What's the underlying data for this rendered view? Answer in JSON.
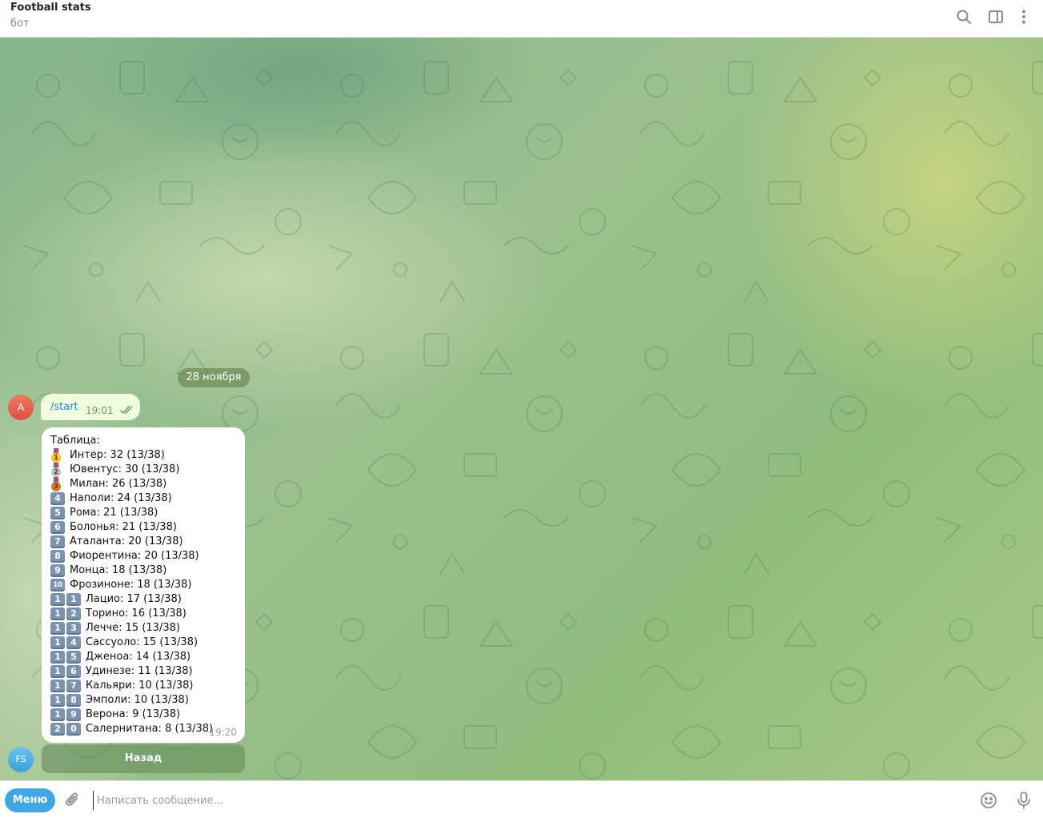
{
  "header": {
    "title": "Football stats",
    "subtitle": "бот"
  },
  "date_separator": "28 ноября",
  "outgoing": {
    "avatar_letter": "A",
    "text": "/start",
    "time": "19:01"
  },
  "incoming": {
    "avatar_letters": "FS",
    "heading": "Таблица:",
    "time": "19:20",
    "rows": [
      {
        "rank": "1",
        "badge": "gold-medal",
        "text": "Интер: 32 (13/38)"
      },
      {
        "rank": "2",
        "badge": "silver-medal",
        "text": "Ювентус: 30 (13/38)"
      },
      {
        "rank": "3",
        "badge": "bronze-medal",
        "text": "Милан: 26 (13/38)"
      },
      {
        "rank": "4",
        "badge": "keycap",
        "text": "Наполи: 24 (13/38)"
      },
      {
        "rank": "5",
        "badge": "keycap",
        "text": "Рома: 21 (13/38)"
      },
      {
        "rank": "6",
        "badge": "keycap",
        "text": "Болонья: 21 (13/38)"
      },
      {
        "rank": "7",
        "badge": "keycap",
        "text": "Аталанта: 20 (13/38)"
      },
      {
        "rank": "8",
        "badge": "keycap",
        "text": "Фиорентина: 20 (13/38)"
      },
      {
        "rank": "9",
        "badge": "keycap",
        "text": "Монца: 18 (13/38)"
      },
      {
        "rank": "10",
        "badge": "keycap",
        "text": "Фрозиноне: 18 (13/38)"
      },
      {
        "rank": "11",
        "badge": "keycap-pair",
        "text": "Лацио: 17 (13/38)"
      },
      {
        "rank": "12",
        "badge": "keycap-pair",
        "text": "Торино: 16 (13/38)"
      },
      {
        "rank": "13",
        "badge": "keycap-pair",
        "text": "Лечче: 15 (13/38)"
      },
      {
        "rank": "14",
        "badge": "keycap-pair",
        "text": "Сассуоло: 15 (13/38)"
      },
      {
        "rank": "15",
        "badge": "keycap-pair",
        "text": "Дженоа: 14 (13/38)"
      },
      {
        "rank": "16",
        "badge": "keycap-pair",
        "text": "Удинезе: 11 (13/38)"
      },
      {
        "rank": "17",
        "badge": "keycap-pair",
        "text": "Кальяри: 10 (13/38)"
      },
      {
        "rank": "18",
        "badge": "keycap-pair",
        "text": "Эмполи: 10 (13/38)"
      },
      {
        "rank": "19",
        "badge": "keycap-pair",
        "text": "Верона: 9 (13/38)"
      },
      {
        "rank": "20",
        "badge": "keycap-pair",
        "text": "Салернитана: 8 (13/38)"
      }
    ],
    "inline_button": "Назад"
  },
  "composer": {
    "menu_label": "Меню",
    "placeholder": "Написать сообщение..."
  },
  "colors": {
    "accent": "#40a7e3",
    "outgoing_bubble": "#effdde",
    "keycap": "#7c93ad",
    "link": "#2b88c4"
  },
  "icons": {
    "header": [
      "search-icon",
      "sidebar-toggle-icon",
      "more-vertical-icon"
    ],
    "composer": [
      "attach-icon",
      "emoji-icon",
      "microphone-icon"
    ]
  }
}
